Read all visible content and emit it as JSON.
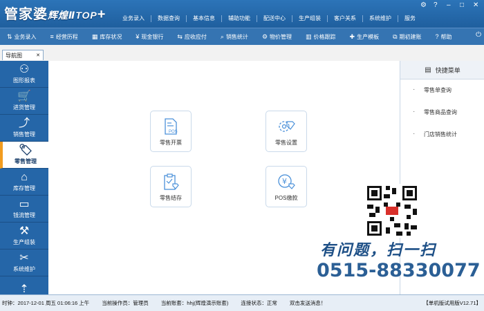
{
  "brand": {
    "name": "管家婆",
    "edition": "辉煌ⅡTOP",
    "plus": "+"
  },
  "top_menu": [
    "业务录入",
    "数据查询",
    "基本信息",
    "辅助功能",
    "配送中心",
    "生产组装",
    "客户关系",
    "系统维护",
    "服务"
  ],
  "window_controls": [
    "⚙",
    "?",
    "–",
    "□",
    "✕"
  ],
  "toolbar": [
    {
      "icon": "⇅",
      "label": "业务录入"
    },
    {
      "icon": "≡",
      "label": "经营历程"
    },
    {
      "icon": "▦",
      "label": "库存状况"
    },
    {
      "icon": "¥",
      "label": "现金银行"
    },
    {
      "icon": "⇆",
      "label": "应收应付"
    },
    {
      "icon": "⌕",
      "label": "销售统计"
    },
    {
      "icon": "⚙",
      "label": "物价管理"
    },
    {
      "icon": "▥",
      "label": "价格跟踪"
    },
    {
      "icon": "✚",
      "label": "生产模板"
    },
    {
      "icon": "⧉",
      "label": "期初建账"
    },
    {
      "icon": "?",
      "label": "帮助"
    }
  ],
  "tabs": [
    {
      "label": "导航图",
      "close": "✕"
    }
  ],
  "sidebar": [
    {
      "icon": "⚇",
      "label": "图形报表"
    },
    {
      "icon": "🛒",
      "label": "进货管理"
    },
    {
      "icon": "⤴",
      "label": "销售管理"
    },
    {
      "icon": "🏷",
      "label": "零售管理",
      "active": true
    },
    {
      "icon": "⌂",
      "label": "库存管理"
    },
    {
      "icon": "▭",
      "label": "钱流管理"
    },
    {
      "icon": "⚒",
      "label": "生产组装"
    },
    {
      "icon": "✂",
      "label": "系统维护"
    },
    {
      "icon": "⇡",
      "label": ""
    }
  ],
  "tiles": [
    {
      "label": "零售开票",
      "icon": "receipt-pos-icon"
    },
    {
      "label": "零售设置",
      "icon": "settings-tag-icon"
    },
    {
      "label": "零售结存",
      "icon": "clipboard-tag-icon"
    },
    {
      "label": "POS缴款",
      "icon": "yen-coin-icon"
    }
  ],
  "tile_icon_text": {
    "pos": "POS",
    "yen": "¥"
  },
  "quick_menu": {
    "title": "快捷菜单",
    "items": [
      "零售单查询",
      "零售商品查询",
      "门店销售统计"
    ]
  },
  "promo": {
    "ask": "有问题，扫一扫",
    "phone": "0515-88330077"
  },
  "status": {
    "time": "时钟：2017-12-01 周五 01:06:16 上午",
    "operator": "当前操作员：管理员",
    "account": "当前账套：hhj(辉煌演示账套)",
    "connection": "连接状态：正常",
    "message": "双击发送消息！",
    "version": "【单机版试用版V12.71】"
  },
  "colors": {
    "header": "#2c74b8",
    "sidebar": "#2566a8",
    "active_marker": "#f29c1f",
    "accent": "#4a90d9"
  }
}
